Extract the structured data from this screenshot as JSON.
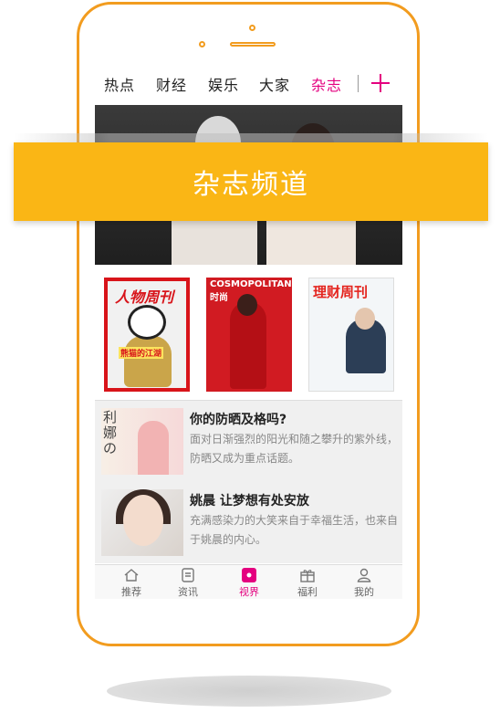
{
  "tabs": {
    "items": [
      "热点",
      "财经",
      "娱乐",
      "大家",
      "杂志"
    ],
    "active": "杂志"
  },
  "banner": {
    "text": "杂志频道"
  },
  "magazines": [
    {
      "title": "人物周刊",
      "tag": "熊猫的江湖"
    },
    {
      "title": "COSMOPOLITAN 时尚"
    },
    {
      "title": "理财周刊"
    }
  ],
  "articles": [
    {
      "thumb_brand": "利娜の",
      "title": "你的防晒及格吗?",
      "desc": "面对日渐强烈的阳光和随之攀升的紫外线，防晒又成为重点话题。"
    },
    {
      "title": "姚晨 让梦想有处安放",
      "desc": "充满感染力的大笑来自于幸福生活，也来自于姚晨的内心。"
    }
  ],
  "bottom_nav": [
    {
      "label": "推荐",
      "icon": "home-icon"
    },
    {
      "label": "资讯",
      "icon": "news-icon"
    },
    {
      "label": "视界",
      "icon": "vision-icon"
    },
    {
      "label": "福利",
      "icon": "gift-icon"
    },
    {
      "label": "我的",
      "icon": "user-icon"
    }
  ],
  "colors": {
    "accent": "#e4007f",
    "frame": "#f29c1f",
    "banner": "#fab615"
  }
}
